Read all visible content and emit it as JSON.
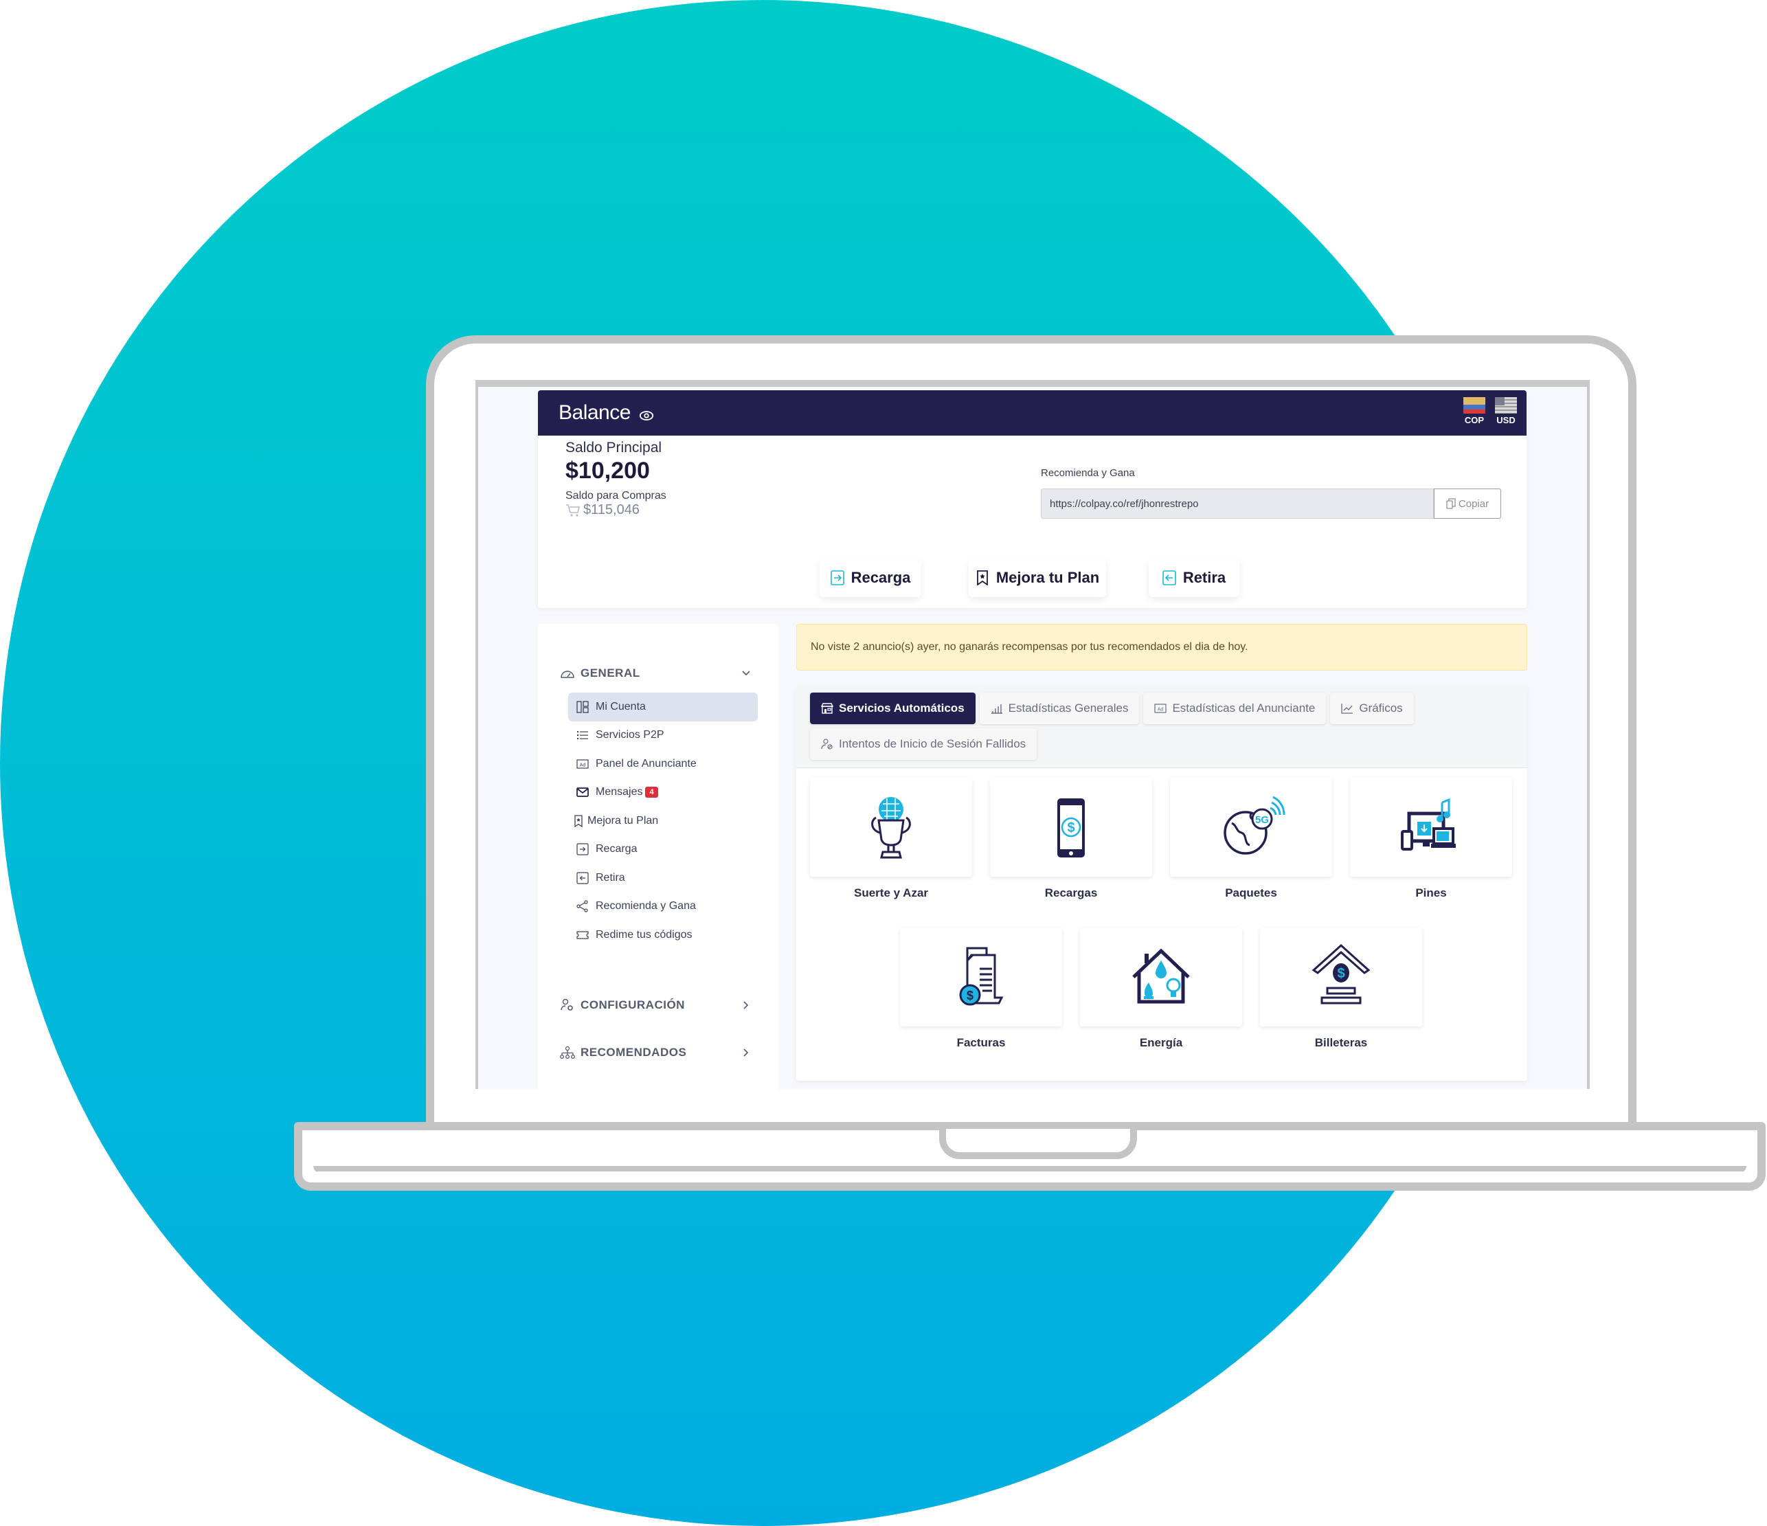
{
  "balance": {
    "title": "Balance",
    "eye_icon": "eye-icon",
    "currencies": [
      {
        "code": "COP",
        "icon": "flag-colombia-icon"
      },
      {
        "code": "USD",
        "icon": "flag-usa-icon"
      }
    ],
    "saldo_principal_label": "Saldo Principal",
    "saldo_principal_value": "$10,200",
    "saldo_compras_label": "Saldo para Compras",
    "saldo_compras_value": "$115,046",
    "referral": {
      "label": "Recomienda y Gana",
      "url": "https://colpay.co/ref/jhonrestrepo",
      "copy_label": "Copiar"
    },
    "actions": [
      {
        "label": "Recarga",
        "icon": "deposit-icon"
      },
      {
        "label": "Mejora tu Plan",
        "icon": "bookmark-star-icon"
      },
      {
        "label": "Retira",
        "icon": "withdraw-icon"
      }
    ]
  },
  "sidebar": {
    "sections": [
      {
        "label": "GENERAL",
        "icon": "speedometer-icon",
        "expanded": true
      },
      {
        "label": "CONFIGURACIÓN",
        "icon": "user-gear-icon",
        "expanded": false
      },
      {
        "label": "RECOMENDADOS",
        "icon": "network-icon",
        "expanded": false
      }
    ],
    "items": [
      {
        "label": "Mi Cuenta",
        "icon": "dashboard-icon",
        "active": true
      },
      {
        "label": "Servicios P2P",
        "icon": "list-icon"
      },
      {
        "label": "Panel de Anunciante",
        "icon": "ad-icon"
      },
      {
        "label": "Mensajes",
        "icon": "envelope-icon",
        "badge": "4"
      },
      {
        "label": "Mejora tu Plan",
        "icon": "bookmark-star-icon"
      },
      {
        "label": "Recarga",
        "icon": "deposit-icon"
      },
      {
        "label": "Retira",
        "icon": "withdraw-icon"
      },
      {
        "label": "Recomienda y Gana",
        "icon": "share-icon"
      },
      {
        "label": "Redime tus códigos",
        "icon": "ticket-icon"
      }
    ]
  },
  "alert": {
    "text": "No viste 2 anuncio(s) ayer, no ganarás recompensas por tus recomendados el dia de hoy."
  },
  "tabs": [
    {
      "label": "Servicios Automáticos",
      "icon": "store-icon",
      "active": true
    },
    {
      "label": "Estadísticas Generales",
      "icon": "bar-chart-icon"
    },
    {
      "label": "Estadísticas del Anunciante",
      "icon": "ad-icon"
    },
    {
      "label": "Gráficos",
      "icon": "line-chart-icon"
    },
    {
      "label": "Intentos de Inicio de Sesión Fallidos",
      "icon": "user-blocked-icon"
    }
  ],
  "services": [
    {
      "label": "Suerte y Azar",
      "icon": "trophy-ball-icon"
    },
    {
      "label": "Recargas",
      "icon": "phone-dollar-icon"
    },
    {
      "label": "Paquetes",
      "icon": "globe-5g-icon"
    },
    {
      "label": "Pines",
      "icon": "devices-media-icon"
    },
    {
      "label": "Facturas",
      "icon": "invoice-dollar-icon"
    },
    {
      "label": "Energía",
      "icon": "house-utilities-icon"
    },
    {
      "label": "Billeteras",
      "icon": "wallet-home-dollar-icon"
    }
  ],
  "colors": {
    "primary_navy": "#22204f",
    "accent_cyan": "#00b4d8",
    "alert_bg": "#fef3cd",
    "badge_red": "#e02d39",
    "bg_circle_top": "#00cbc8",
    "bg_circle_bottom": "#00ade0"
  }
}
